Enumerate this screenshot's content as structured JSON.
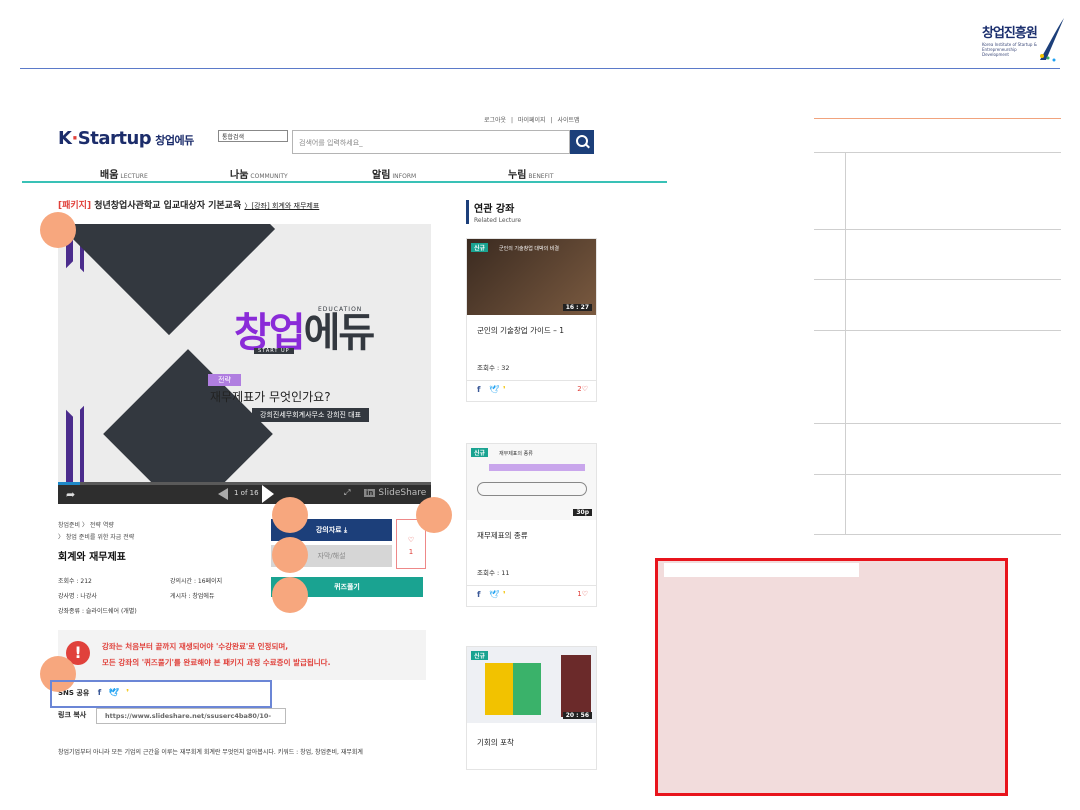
{
  "org_logo": {
    "name": "창업진흥원",
    "subtitle": "Korea Institute of Startup & Entrepreneurship Development"
  },
  "utility_links": [
    "로그아웃",
    "|",
    "마이페이지",
    "|",
    "사이트맵"
  ],
  "site": {
    "logo_k": "K",
    "logo_rest": "Startup",
    "logo_suffix": "창업에듀"
  },
  "search": {
    "category": "통합검색",
    "placeholder": "검색어를 입력하세요_"
  },
  "gnb": [
    {
      "ko": "배움",
      "en": "LECTURE"
    },
    {
      "ko": "나눔",
      "en": "COMMUNITY"
    },
    {
      "ko": "알림",
      "en": "INFORM"
    },
    {
      "ko": "누림",
      "en": "BENEFIT"
    }
  ],
  "breadcrumb": {
    "tag": "[패키지]",
    "package": "청년창업사관학교 입교대상자 기본교육",
    "arrow": "〉",
    "lecture": "[강좌] 회계와 재무제표"
  },
  "slide": {
    "brand_1": "창업",
    "brand_2": "에듀",
    "edu_word": "EDUCATION",
    "startup_word": "START UP",
    "pill": "전략",
    "question": "재무제표가 무엇인가요?",
    "speaker": "강희진세무회계사무소 강희진 대표"
  },
  "player": {
    "page": "1 of 16",
    "brand": "SlideShare",
    "in": "in",
    "progress": 0.06
  },
  "lecture_info": {
    "path1": "창업준비 〉 전략 역량",
    "path2": "〉 창업 준비를 위한 자금 전략",
    "title": "회계와 재무제표",
    "views": "조회수 : 212",
    "time": "강의시간 : 16페이지",
    "instructor": "강사명 : 나강사",
    "poster": "게시자 : 창업에듀",
    "type": "강좌종류 : 슬라이드쉐어 (개별)"
  },
  "buttons": {
    "download": "강의자료  ⤓",
    "subtitle": "자막/해설",
    "quiz": "퀴즈풀기",
    "like_heart": "♡",
    "like_count": "1"
  },
  "notice": {
    "icon": "!",
    "line1": "강좌는 처음부터 끝까지 재생되어야 '수강완료'로 인정되며,",
    "line2": "모든 강좌의 '퀴즈풀기'를 완료해야 본 패키지 과정 수료증이 발급됩니다."
  },
  "share": {
    "sns_label": "SNS 공유",
    "fb": "f",
    "tw": "🐦",
    "ks": "❜",
    "link_label": "링크 복사",
    "link_value": "https://www.slideshare.net/ssuserc4ba80/10-"
  },
  "description": "창업기업부터 아니라 모든 기업의 근간을 이루는 재무회계 회계란 무엇인지 알아봅시다. 키워드 : 창업, 창업준비, 재무회계",
  "related": {
    "title": "연관 강좌",
    "subtitle": "Related Lecture",
    "cards": [
      {
        "badge": "신규",
        "thumb_title": "군인의 기술창업 대박의 비결",
        "duration": "16 : 27",
        "title": "군인의 기술창업 가이드 – 1",
        "views": "조회수 : 32",
        "likes": "2♡"
      },
      {
        "badge": "신규",
        "thumb_title": "재무제표의 종류",
        "duration": "30p",
        "title": "재무제표의 종류",
        "views": "조회수 : 11",
        "likes": "1♡"
      },
      {
        "badge": "신규",
        "thumb_title": "기회의 포착",
        "duration": "20 : 56",
        "title": "기회의 포착",
        "views": "",
        "likes": ""
      }
    ]
  },
  "colors": {
    "accent": "#1c3f7a",
    "teal": "#1aa391",
    "red": "#e0413b",
    "callout": "#f7a77e",
    "redbox": "#e8141c"
  }
}
